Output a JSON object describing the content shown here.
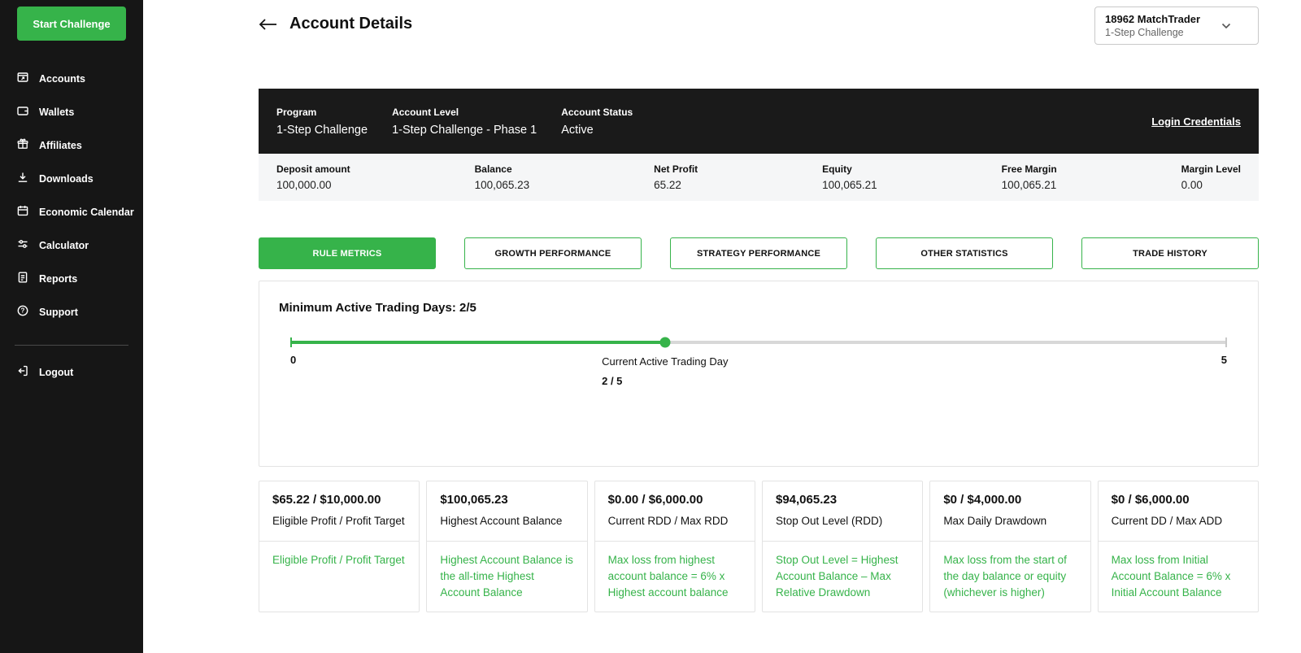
{
  "colors": {
    "accent_green": "#36b34a",
    "sidebar_bg": "#161616",
    "dark_bar_bg": "#1a1a1a"
  },
  "sidebar": {
    "start_challenge_label": "Start Challenge",
    "items": [
      {
        "label": "Accounts",
        "icon": "accounts-icon"
      },
      {
        "label": "Wallets",
        "icon": "wallets-icon"
      },
      {
        "label": "Affiliates",
        "icon": "affiliates-icon"
      },
      {
        "label": "Downloads",
        "icon": "downloads-icon"
      },
      {
        "label": "Economic Calendar",
        "icon": "economic-calendar-icon"
      },
      {
        "label": "Calculator",
        "icon": "calculator-icon"
      },
      {
        "label": "Reports",
        "icon": "reports-icon"
      },
      {
        "label": "Support",
        "icon": "support-icon"
      }
    ],
    "logout_label": "Logout"
  },
  "header": {
    "title": "Account Details",
    "account_selector": {
      "line1": "18962 MatchTrader",
      "line2": "1-Step Challenge"
    }
  },
  "account_bar": {
    "fields": [
      {
        "label": "Program",
        "value": "1-Step Challenge"
      },
      {
        "label": "Account Level",
        "value": "1-Step Challenge - Phase 1"
      },
      {
        "label": "Account Status",
        "value": "Active"
      }
    ],
    "login_credentials_label": "Login Credentials"
  },
  "stats": [
    {
      "label": "Deposit amount",
      "value": "100,000.00"
    },
    {
      "label": "Balance",
      "value": "100,065.23"
    },
    {
      "label": "Net Profit",
      "value": "65.22"
    },
    {
      "label": "Equity",
      "value": "100,065.21"
    },
    {
      "label": "Free Margin",
      "value": "100,065.21"
    },
    {
      "label": "Margin Level",
      "value": "0.00"
    }
  ],
  "tabs": [
    {
      "label": "RULE METRICS",
      "active": true
    },
    {
      "label": "GROWTH PERFORMANCE",
      "active": false
    },
    {
      "label": "STRATEGY PERFORMANCE",
      "active": false
    },
    {
      "label": "OTHER STATISTICS",
      "active": false
    },
    {
      "label": "TRADE HISTORY",
      "active": false
    }
  ],
  "trading_days": {
    "title": "Minimum Active Trading Days: 2/5",
    "min_label": "0",
    "max_label": "5",
    "current_label": "Current Active Trading Day",
    "current_value": "2 / 5",
    "progress_pct": 40
  },
  "metric_cards": [
    {
      "value": "$65.22 / $10,000.00",
      "label": "Eligible Profit / Profit Target",
      "description": "Eligible Profit / Profit Target"
    },
    {
      "value": "$100,065.23",
      "label": "Highest Account Balance",
      "description": "Highest Account Balance is the all-time Highest Account Balance"
    },
    {
      "value": "$0.00 / $6,000.00",
      "label": "Current RDD / Max RDD",
      "description": "Max loss from highest account balance = 6% x Highest account balance"
    },
    {
      "value": "$94,065.23",
      "label": "Stop Out Level (RDD)",
      "description": "Stop Out Level = Highest Account Balance – Max Relative Drawdown"
    },
    {
      "value": "$0 / $4,000.00",
      "label": "Max Daily Drawdown",
      "description": "Max loss from the start of the day balance or equity (whichever is higher)"
    },
    {
      "value": "$0 / $6,000.00",
      "label": "Current DD / Max ADD",
      "description": "Max loss from Initial Account Balance = 6% x Initial Account Balance"
    }
  ]
}
